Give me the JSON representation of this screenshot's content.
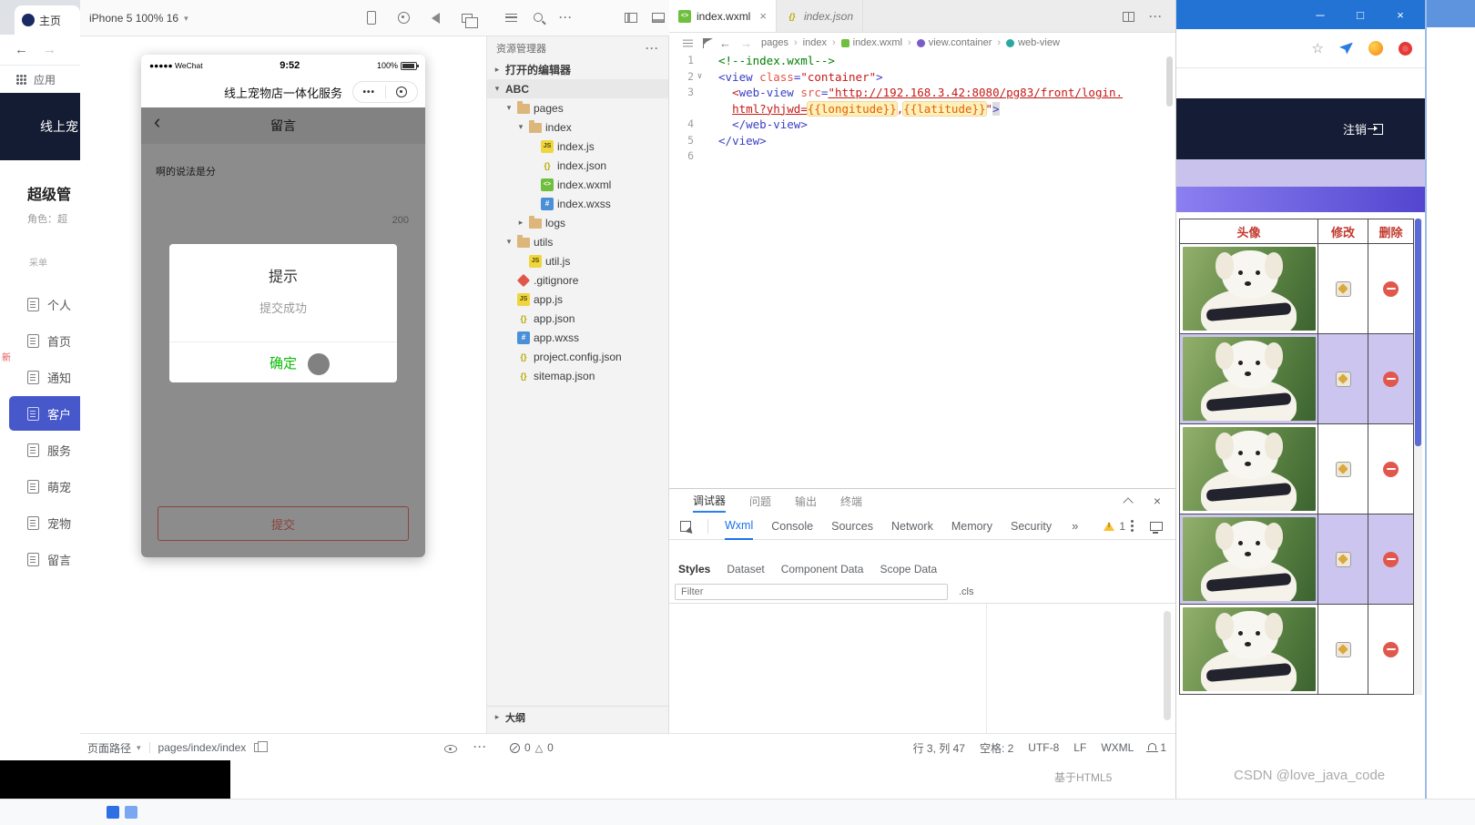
{
  "left_browser": {
    "tab_title": "主页",
    "apps_label": "应用",
    "site_title": "线上宠",
    "panel_title": "超级管",
    "panel_subtitle": "角色：超",
    "menu_section": "采单",
    "new_badge": "新",
    "menu_items": [
      {
        "label": "个人",
        "key": "profile",
        "active": false
      },
      {
        "label": "首页",
        "key": "home",
        "active": false
      },
      {
        "label": "通知",
        "key": "notifications",
        "active": false
      },
      {
        "label": "客户",
        "key": "customers",
        "active": true
      },
      {
        "label": "服务",
        "key": "services",
        "active": false
      },
      {
        "label": "萌宠",
        "key": "cute-pets",
        "active": false
      },
      {
        "label": "宠物",
        "key": "pets",
        "active": false
      },
      {
        "label": "留言",
        "key": "messages",
        "active": false
      }
    ]
  },
  "toolbar": {
    "device_label": "iPhone 5 100% 16"
  },
  "simulator": {
    "carrier": "●●●●● WeChat",
    "time": "9:52",
    "battery_pct": "100%",
    "nav_title": "线上宠物店一体化服务",
    "page_title": "留言",
    "textarea_text": "啊的说法是分",
    "char_counter": "200",
    "submit_label": "提交",
    "modal_title": "提示",
    "modal_message": "提交成功",
    "modal_confirm": "确定",
    "path_label": "页面路径",
    "page_path": "pages/index/index"
  },
  "explorer": {
    "title": "资源管理器",
    "tree": [
      {
        "label": "打开的编辑器",
        "key": "open-editors",
        "indent": 0,
        "arrow": "collapsed",
        "section": true
      },
      {
        "label": "ABC",
        "key": "project-abc",
        "indent": 0,
        "arrow": "expanded",
        "section": true
      },
      {
        "label": "pages",
        "key": "pages",
        "indent": 1,
        "arrow": "expanded",
        "icon": "folder"
      },
      {
        "label": "index",
        "key": "index",
        "indent": 2,
        "arrow": "expanded",
        "icon": "folder"
      },
      {
        "label": "index.js",
        "key": "index-js",
        "indent": 3,
        "icon": "js"
      },
      {
        "label": "index.json",
        "key": "index-json",
        "indent": 3,
        "icon": "json"
      },
      {
        "label": "index.wxml",
        "key": "index-wxml",
        "indent": 3,
        "icon": "wxml"
      },
      {
        "label": "index.wxss",
        "key": "index-wxss",
        "indent": 3,
        "icon": "wxss"
      },
      {
        "label": "logs",
        "key": "logs",
        "indent": 2,
        "arrow": "collapsed",
        "icon": "folder"
      },
      {
        "label": "utils",
        "key": "utils",
        "indent": 1,
        "arrow": "expanded",
        "icon": "folder"
      },
      {
        "label": "util.js",
        "key": "util-js",
        "indent": 2,
        "icon": "js"
      },
      {
        "label": ".gitignore",
        "key": "gitignore",
        "indent": 1,
        "icon": "git"
      },
      {
        "label": "app.js",
        "key": "app-js",
        "indent": 1,
        "icon": "js"
      },
      {
        "label": "app.json",
        "key": "app-json",
        "indent": 1,
        "icon": "json"
      },
      {
        "label": "app.wxss",
        "key": "app-wxss",
        "indent": 1,
        "icon": "wxss"
      },
      {
        "label": "project.config.json",
        "key": "project-config-json",
        "indent": 1,
        "icon": "json"
      },
      {
        "label": "sitemap.json",
        "key": "sitemap-json",
        "indent": 1,
        "icon": "json"
      }
    ],
    "outline_label": "大纲"
  },
  "editor": {
    "tabs": [
      {
        "label": "index.wxml",
        "key": "index-wxml",
        "icon": "wxml",
        "active": true,
        "close": true
      },
      {
        "label": "index.json",
        "key": "index-json",
        "icon": "json",
        "italic": true
      }
    ],
    "breadcrumb": [
      {
        "label": "pages",
        "key": "pages"
      },
      {
        "label": "index",
        "key": "index"
      },
      {
        "label": "index.wxml",
        "key": "index-wxml",
        "icon": "wxml"
      },
      {
        "label": "view.container",
        "key": "view-container",
        "icon": "container"
      },
      {
        "label": "web-view",
        "key": "web-view",
        "icon": "webview"
      }
    ],
    "code": [
      {
        "num": "1",
        "tokens": [
          [
            "cm",
            "<!--index.wxml-->"
          ]
        ]
      },
      {
        "num": "2",
        "fold": true,
        "tokens": [
          [
            "pu",
            "<"
          ],
          [
            "tag",
            "view"
          ],
          [
            "df",
            " "
          ],
          [
            "attr",
            "class"
          ],
          [
            "pu",
            "="
          ],
          [
            "str",
            "\"container\""
          ],
          [
            "pu",
            ">"
          ]
        ]
      },
      {
        "num": "3",
        "tokens": [
          [
            "df",
            "  "
          ],
          [
            "pur",
            "<"
          ],
          [
            "tag",
            "web-view"
          ],
          [
            "df",
            " "
          ],
          [
            "attr",
            "src"
          ],
          [
            "pu",
            "="
          ],
          [
            "strl",
            "\"http://192.168.3.42:8080/pg83/front/login."
          ]
        ]
      },
      {
        "num": "",
        "tokens": [
          [
            "df",
            "  "
          ],
          [
            "strl",
            "html?yhjwd="
          ],
          [
            "int",
            "{{longitude}}"
          ],
          [
            "str",
            ","
          ],
          [
            "int",
            "{{latitude}}"
          ],
          [
            "str",
            "\""
          ],
          [
            "puh",
            ">"
          ]
        ]
      },
      {
        "num": "4",
        "tokens": [
          [
            "df",
            "  "
          ],
          [
            "pu",
            "</"
          ],
          [
            "tag",
            "web-view"
          ],
          [
            "pu",
            ">"
          ]
        ]
      },
      {
        "num": "5",
        "tokens": [
          [
            "pu",
            "</"
          ],
          [
            "tag",
            "view"
          ],
          [
            "pu",
            ">"
          ]
        ]
      },
      {
        "num": "6",
        "tokens": []
      }
    ]
  },
  "debugger": {
    "panel_tabs": [
      {
        "label": "调试器",
        "key": "debugger",
        "active": true
      },
      {
        "label": "问题",
        "key": "problems"
      },
      {
        "label": "输出",
        "key": "output"
      },
      {
        "label": "终端",
        "key": "terminal"
      }
    ],
    "devtools_tabs": [
      {
        "label": "Wxml",
        "active": true
      },
      {
        "label": "Console"
      },
      {
        "label": "Sources"
      },
      {
        "label": "Network"
      },
      {
        "label": "Memory"
      },
      {
        "label": "Security"
      }
    ],
    "overflow_icon": "»",
    "warning_count": "1",
    "subtabs": [
      {
        "label": "Styles",
        "active": true
      },
      {
        "label": "Dataset"
      },
      {
        "label": "Component Data"
      },
      {
        "label": "Scope Data"
      }
    ],
    "filter_placeholder": "Filter",
    "cls_label": ".cls"
  },
  "statusbar": {
    "errors": "0",
    "warnings": "0",
    "cursor_pos": "行 3, 列 47",
    "spaces": "空格: 2",
    "encoding": "UTF-8",
    "eol": "LF",
    "language": "WXML",
    "notif_count": "1"
  },
  "right_browser": {
    "logout_label": "注销",
    "table_headers": [
      {
        "label": "头像",
        "key": "avatar"
      },
      {
        "label": "修改",
        "key": "modify"
      },
      {
        "label": "删除",
        "key": "delete"
      }
    ],
    "rows": [
      {
        "photo": "white-dog"
      },
      {
        "photo": "white-dog"
      },
      {
        "photo": "white-dog"
      },
      {
        "photo": "white-dog"
      },
      {
        "photo": "white-dog"
      }
    ]
  },
  "watermark": "CSDN @love_java_code",
  "footer_note": "基于HTML5"
}
